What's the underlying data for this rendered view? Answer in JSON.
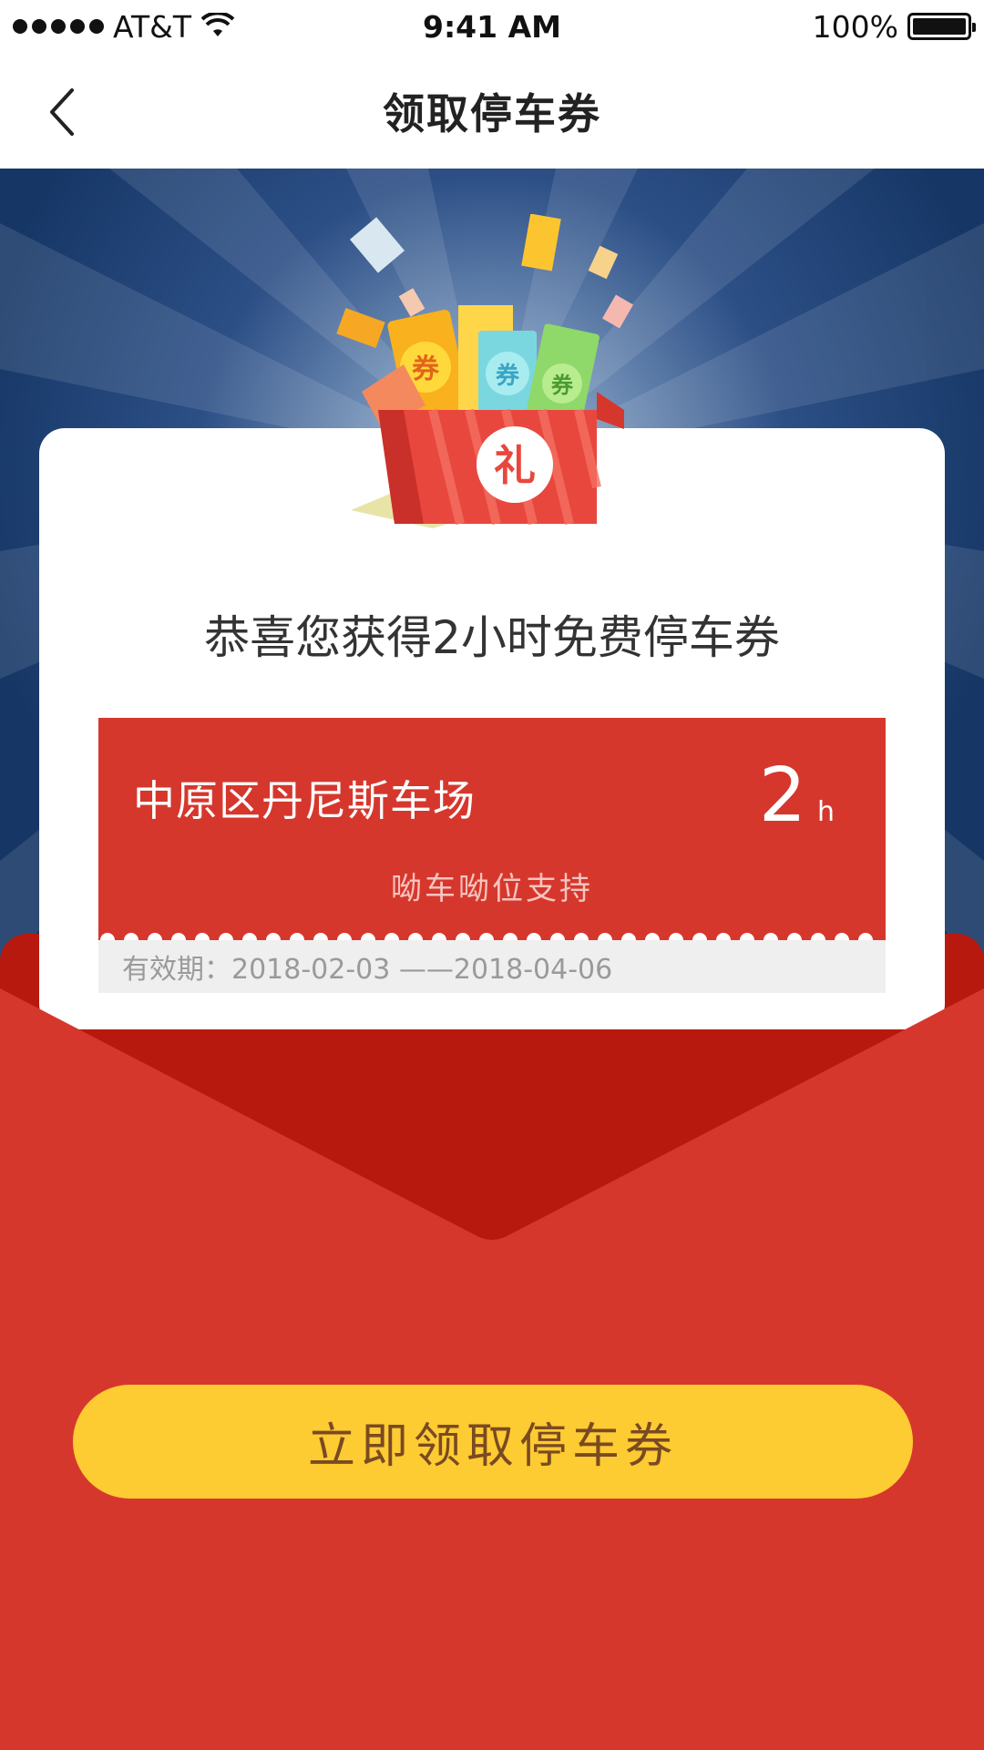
{
  "status_bar": {
    "carrier": "AT&T",
    "time": "9:41 AM",
    "battery": "100%",
    "battery_level": 1.0
  },
  "nav": {
    "title": "领取停车券"
  },
  "card": {
    "gift_char": "礼",
    "coupon_char": "券",
    "congrats": "恭喜您获得2小时免费停车券"
  },
  "coupon": {
    "lot_name": "中原区丹尼斯车场",
    "hours": "2",
    "hours_unit": "h",
    "support": "呦车呦位支持",
    "validity": "有效期：2018-02-03 ——2018-04-06"
  },
  "actions": {
    "claim_label": "立即领取停车券"
  },
  "colors": {
    "hero_bg": "#163766",
    "envelope_red": "#d6372d",
    "envelope_dark": "#b8190f",
    "button_yellow": "#fdcb32",
    "button_text": "#7a4a22"
  }
}
